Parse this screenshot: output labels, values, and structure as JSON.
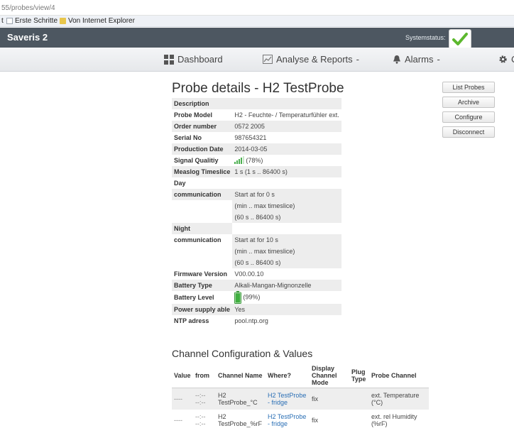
{
  "browser": {
    "url": "55/probes/view/4",
    "bookmarks": [
      {
        "label": "Erste Schritte"
      },
      {
        "label": "Von Internet Explorer"
      }
    ],
    "bookmarks_prefix": "t"
  },
  "app": {
    "brand": "Saveris 2",
    "status_label": "Systemstatus:",
    "status_color": "#5cb82e"
  },
  "nav": {
    "dashboard": "Dashboard",
    "analyse": "Analyse & Reports",
    "alarms": "Alarms",
    "settings_partial": "C"
  },
  "page": {
    "title": "Probe details - H2 TestProbe",
    "details": {
      "description_label": "Description",
      "probe_model_label": "Probe Model",
      "probe_model": "H2 - Feuchte- / Temperaturfühler ext.",
      "order_label": "Order number",
      "order": "0572 2005",
      "serial_label": "Serial No",
      "serial": "987654321",
      "production_label": "Production Date",
      "production": "2014-03-05",
      "signal_label": "Signal Qualitiy",
      "signal": "(78%)",
      "signal_fraction": 0.78,
      "measlog_label": "Measlog Timeslice",
      "measlog": "1 s (1 s .. 86400 s)",
      "day_label": "Day",
      "day_comm_label": "communication",
      "day_comm_1": "Start at for 0 s",
      "day_comm_2": "(min .. max timeslice)",
      "day_comm_3": "(60 s .. 86400 s)",
      "night_label": "Night",
      "night_comm_label": "communication",
      "night_comm_1": "Start at for 10 s",
      "night_comm_2": "(min .. max timeslice)",
      "night_comm_3": "(60 s .. 86400 s)",
      "firmware_label": "Firmware Version",
      "firmware": "V00.00.10",
      "battery_type_label": "Battery Type",
      "battery_type": "Alkali-Mangan-Mignonzelle",
      "battery_level_label": "Battery Level",
      "battery_level": "(99%)",
      "battery_fraction": 0.99,
      "power_label": "Power supply able",
      "power": "Yes",
      "ntp_label": "NTP adress",
      "ntp": "pool.ntp.org"
    },
    "actions": {
      "list_probes": "List Probes",
      "archive": "Archive",
      "configure": "Configure",
      "disconnect": "Disconnect"
    },
    "channels": {
      "title": "Channel Configuration & Values",
      "headers": {
        "value": "Value",
        "from": "from",
        "channel_name": "Channel Name",
        "where": "Where?",
        "display_mode": "Display Channel Mode",
        "plug_type": "Plug Type",
        "probe_channel": "Probe Channel"
      },
      "rows": [
        {
          "value": "----",
          "from": "--:--",
          "from2": "--:--",
          "name": "H2 TestProbe_°C",
          "where": "H2 TestProbe - fridge",
          "mode": "fix",
          "plug": "",
          "probe_channel": "ext. Temperature (°C)"
        },
        {
          "value": "----",
          "from": "--:--",
          "from2": "--:--",
          "name": "H2 TestProbe_%rF",
          "where": "H2 TestProbe - fridge",
          "mode": "fix",
          "plug": "",
          "probe_channel": "ext. rel Humidity (%rF)"
        }
      ]
    }
  }
}
